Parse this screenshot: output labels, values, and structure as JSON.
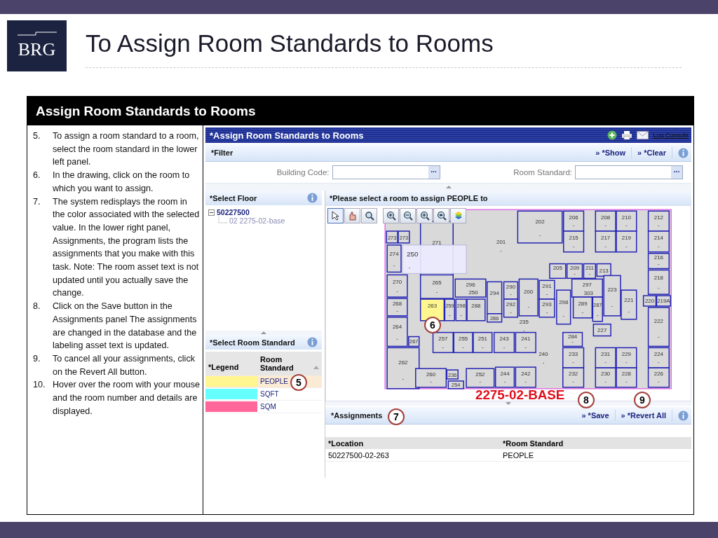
{
  "slide": {
    "logo": "BRG",
    "title": "To Assign Room Standards to Rooms",
    "box_title": "Assign Room Standards to Rooms",
    "steps": [
      {
        "number": "5.",
        "text": "To assign a room standard to a room, select the room standard in the lower left panel."
      },
      {
        "number": "6.",
        "text": "In the drawing, click on the room to which you want to assign."
      },
      {
        "number": "7.",
        "text": "The system redisplays the room in the color associated with the selected value. In the lower right panel, Assignments, the program lists the assignments that you make with this task. Note:  The room asset text is not updated until you actually save the change."
      },
      {
        "number": "8.",
        "text": "Click on the Save button in the Assignments panel  The assignments are changed in the database and the labeling asset text is updated."
      },
      {
        "number": "9.",
        "text": "To cancel all your assignments, click on the Revert All button."
      },
      {
        "number": "10.",
        "text": "Hover over the room with your mouse and the room number and details are displayed."
      }
    ]
  },
  "app": {
    "title": "*Assign Room Standards to Rooms",
    "log_console": "Log Console",
    "filter": {
      "title": "*Filter",
      "actions": [
        "» *Show",
        "» *Clear"
      ],
      "fields": [
        {
          "label": "Building Code:",
          "button": "..."
        },
        {
          "label": "Room Standard:",
          "button": "..."
        }
      ]
    },
    "floor_panel": {
      "title": "*Select Floor",
      "tree": [
        {
          "label": "50227500",
          "expanded": true,
          "children": [
            {
              "label": "02 2275-02-base"
            }
          ]
        }
      ]
    },
    "standard_panel": {
      "title": "*Select Room Standard",
      "columns": [
        "*Legend",
        "Room Standard"
      ],
      "rows": [
        {
          "name": "PEOPLE",
          "color": "#fff68f",
          "selected": true
        },
        {
          "name": "SQFT",
          "color": "#66ffff",
          "selected": false
        },
        {
          "name": "SQM",
          "color": "#ff6699",
          "selected": false
        }
      ]
    },
    "map_panel": {
      "title": "*Please select a room to assign PEOPLE to",
      "drawing_label": "2275-02-BASE",
      "tooltip": {
        "number": "250",
        "detail": "-"
      },
      "rooms": [
        {
          "number": "202",
          "detail": "-",
          "color": "#d9d9d9"
        },
        {
          "number": "206",
          "detail": "-",
          "color": "#d9d9d9"
        },
        {
          "number": "208",
          "detail": "-",
          "color": "#d9d9d9"
        },
        {
          "number": "210",
          "detail": "-",
          "color": "#d9d9d9"
        },
        {
          "number": "212",
          "detail": "-",
          "color": "#d9d9d9"
        },
        {
          "number": "273",
          "color": "#d9d9d9"
        },
        {
          "number": "273",
          "color": "#d9d9d9"
        },
        {
          "number": "271",
          "color": "#d9d9d9"
        },
        {
          "number": "215",
          "detail": "-",
          "color": "#d9d9d9"
        },
        {
          "number": "217",
          "detail": "-",
          "color": "#d9d9d9"
        },
        {
          "number": "219",
          "detail": "-",
          "color": "#d9d9d9"
        },
        {
          "number": "214",
          "detail": "-",
          "color": "#d9d9d9"
        },
        {
          "number": "274",
          "detail": "-",
          "color": "#d9d9d9"
        },
        {
          "number": "201",
          "detail": "-"
        },
        {
          "number": "216",
          "detail": "-",
          "color": "#d9d9d9"
        },
        {
          "number": "205",
          "color": "#d9d9d9"
        },
        {
          "number": "209",
          "detail": "-",
          "color": "#d9d9d9"
        },
        {
          "number": "211",
          "detail": "-",
          "color": "#d9d9d9"
        },
        {
          "number": "213",
          "color": "#d9d9d9"
        },
        {
          "number": "218",
          "detail": "-",
          "color": "#d9d9d9"
        },
        {
          "number": "270",
          "detail": "-",
          "color": "#d9d9d9"
        },
        {
          "number": "265",
          "detail": "-",
          "color": "#d9d9d9"
        },
        {
          "number": "296",
          "color": "#d9d9d9"
        },
        {
          "number": "294",
          "color": "#d9d9d9"
        },
        {
          "number": "290",
          "detail": "-",
          "color": "#d9d9d9"
        },
        {
          "number": "200",
          "detail": "-",
          "color": "#d9d9d9"
        },
        {
          "number": "291",
          "detail": "-",
          "color": "#d9d9d9"
        },
        {
          "number": "297",
          "color": "#d9d9d9"
        },
        {
          "number": "223",
          "detail": "-",
          "color": "#d9d9d9"
        },
        {
          "number": "268",
          "detail": "-",
          "color": "#d9d9d9"
        },
        {
          "number": "263",
          "color": "#fff68f"
        },
        {
          "number": "259",
          "detail": "-",
          "color": "#d9d9d9"
        },
        {
          "number": "298",
          "detail": "-",
          "color": "#d9d9d9"
        },
        {
          "number": "288",
          "color": "#d9d9d9"
        },
        {
          "number": "250"
        },
        {
          "number": "292",
          "detail": "-",
          "color": "#d9d9d9"
        },
        {
          "number": "293",
          "detail": "-",
          "color": "#d9d9d9"
        },
        {
          "number": "298",
          "detail": "-",
          "color": "#d9d9d9"
        },
        {
          "number": "289",
          "detail": "-",
          "color": "#d9d9d9"
        },
        {
          "number": "303"
        },
        {
          "number": "287",
          "detail": "-",
          "color": "#d9d9d9"
        },
        {
          "number": "221",
          "detail": "-",
          "color": "#d9d9d9"
        },
        {
          "number": "220",
          "color": "#d9d9d9"
        },
        {
          "number": "219A",
          "color": "#d9d9d9"
        },
        {
          "number": "264",
          "detail": "-",
          "color": "#d9d9d9"
        },
        {
          "number": "286",
          "color": "#d9d9d9"
        },
        {
          "number": "235",
          "detail": "-"
        },
        {
          "number": "227",
          "color": "#d9d9d9"
        },
        {
          "number": "222",
          "detail": "-",
          "color": "#d9d9d9"
        },
        {
          "number": "267",
          "color": "#d9d9d9"
        },
        {
          "number": "257",
          "detail": "-",
          "color": "#d9d9d9"
        },
        {
          "number": "255",
          "detail": "-",
          "color": "#d9d9d9"
        },
        {
          "number": "251",
          "detail": "-",
          "color": "#d9d9d9"
        },
        {
          "number": "243",
          "detail": "-",
          "color": "#d9d9d9"
        },
        {
          "number": "241",
          "detail": "-",
          "color": "#d9d9d9"
        },
        {
          "number": "284",
          "detail": "-",
          "color": "#d9d9d9"
        },
        {
          "number": "262",
          "detail": "-",
          "color": "#d9d9d9"
        },
        {
          "number": "240",
          "detail": "-"
        },
        {
          "number": "233",
          "detail": "-",
          "color": "#d9d9d9"
        },
        {
          "number": "231",
          "detail": "-",
          "color": "#d9d9d9"
        },
        {
          "number": "229",
          "detail": "-",
          "color": "#d9d9d9"
        },
        {
          "number": "224",
          "detail": "-",
          "color": "#d9d9d9"
        },
        {
          "number": "260",
          "detail": "-",
          "color": "#d9d9d9"
        },
        {
          "number": "236",
          "color": "#d9d9d9"
        },
        {
          "number": "254",
          "color": "#d9d9d9"
        },
        {
          "number": "252",
          "detail": "-",
          "color": "#d9d9d9"
        },
        {
          "number": "244",
          "detail": "-",
          "color": "#d9d9d9"
        },
        {
          "number": "242",
          "detail": "-",
          "color": "#d9d9d9"
        },
        {
          "number": "232",
          "detail": "-",
          "color": "#d9d9d9"
        },
        {
          "number": "230",
          "detail": "-",
          "color": "#d9d9d9"
        },
        {
          "number": "228",
          "detail": "-",
          "color": "#d9d9d9"
        },
        {
          "number": "226",
          "detail": "-",
          "color": "#d9d9d9"
        }
      ]
    },
    "assignments": {
      "title": "*Assignments",
      "actions": [
        "» *Save",
        "» *Revert All"
      ],
      "columns": [
        "*Location",
        "*Room Standard"
      ],
      "rows": [
        [
          "50227500-02-263",
          "PEOPLE"
        ]
      ]
    }
  },
  "callouts": [
    "5",
    "6",
    "7",
    "8",
    "9"
  ]
}
